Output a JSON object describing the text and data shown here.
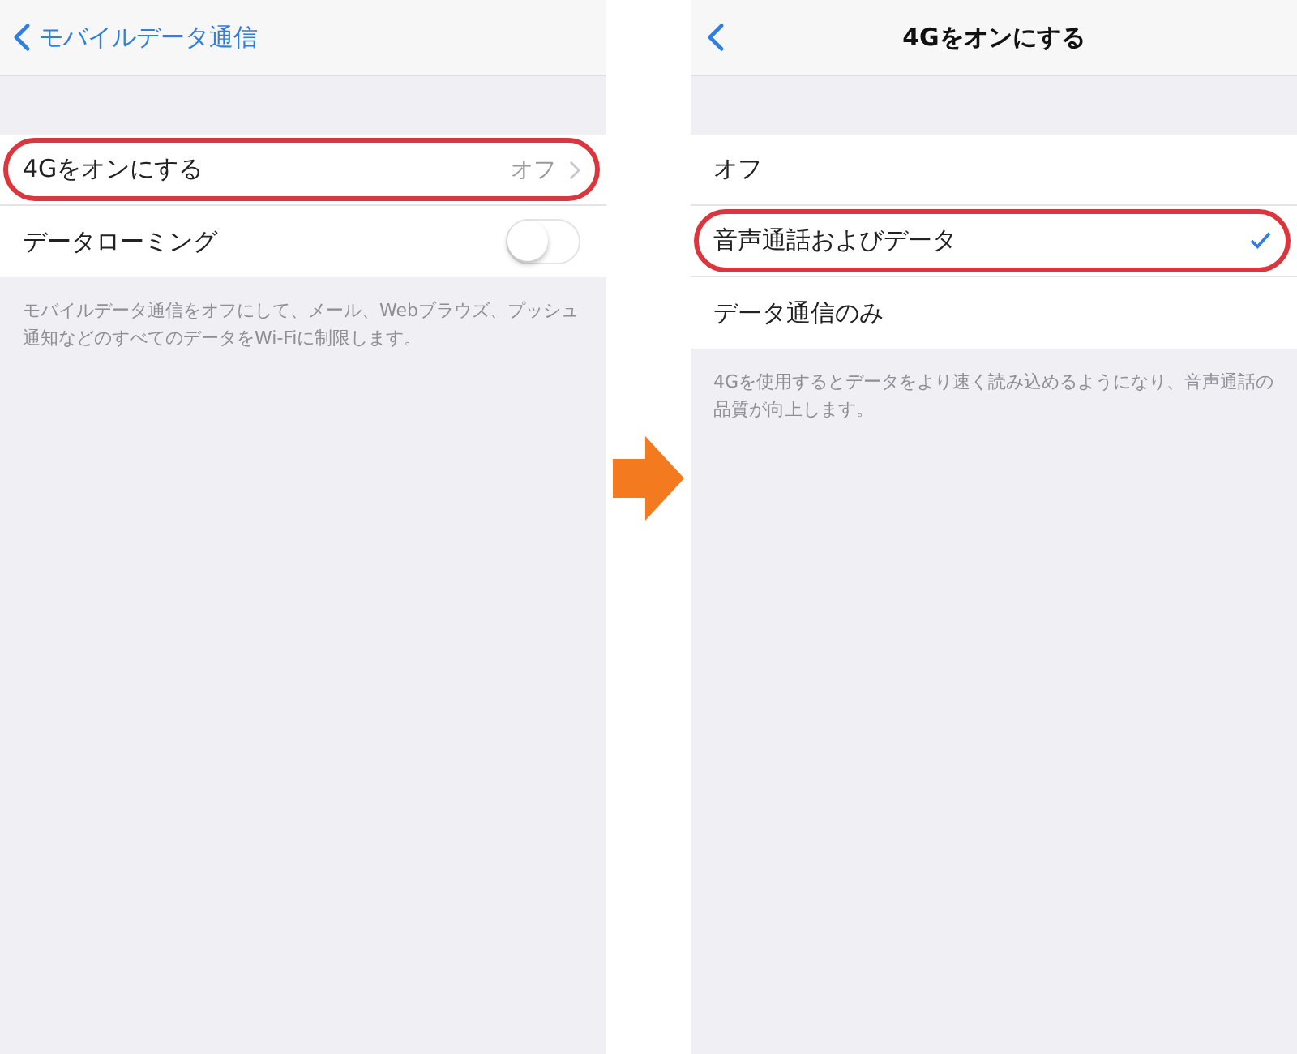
{
  "left_screen": {
    "nav": {
      "back_label": "モバイルデータ通信"
    },
    "rows": [
      {
        "kind": "disclosure",
        "label": "4Gをオンにする",
        "value": "オフ",
        "highlighted": true
      },
      {
        "kind": "toggle",
        "label": "データローミング",
        "on": false,
        "highlighted": false
      }
    ],
    "footer": "モバイルデータ通信をオフにして、メール、Webブラウズ、プッシュ通知などのすべてのデータをWi-Fiに制限します。"
  },
  "right_screen": {
    "nav": {
      "title": "4Gをオンにする"
    },
    "options": [
      {
        "label": "オフ",
        "selected": false,
        "highlighted": false
      },
      {
        "label": "音声通話およびデータ",
        "selected": true,
        "highlighted": true
      },
      {
        "label": "データ通信のみ",
        "selected": false,
        "highlighted": false
      }
    ],
    "footer": "4Gを使用するとデータをより速く読み込めるようになり、音声通話の品質が向上します。"
  }
}
